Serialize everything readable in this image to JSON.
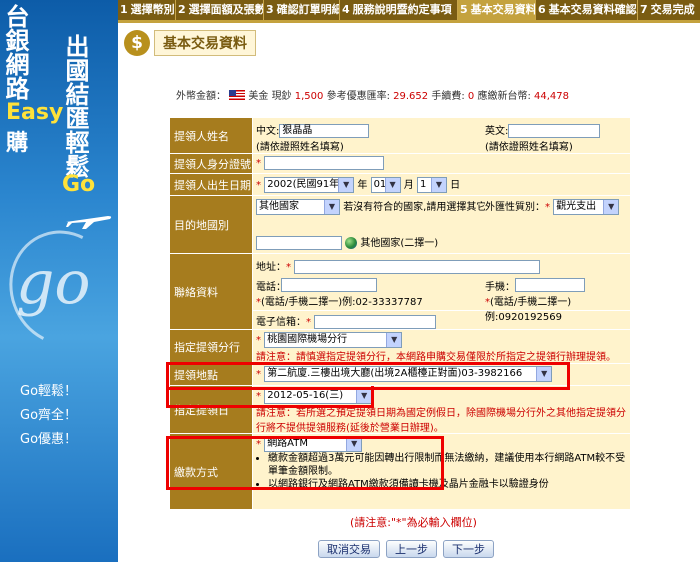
{
  "sidebar": {
    "title_left": "台銀網路",
    "title_right": "出國結匯輕鬆",
    "easy": "Easy",
    "buy": "購",
    "go": "Go",
    "slogans": [
      "Go輕鬆！",
      "Go齊全！",
      "Go優惠！"
    ]
  },
  "steps": [
    {
      "num": "1",
      "label": "選擇幣別"
    },
    {
      "num": "2",
      "label": "選擇面額及張數"
    },
    {
      "num": "3",
      "label": "確認訂單明細"
    },
    {
      "num": "4",
      "label": "服務說明暨約定事項"
    },
    {
      "num": "5",
      "label": "基本交易資料"
    },
    {
      "num": "6",
      "label": "基本交易資料確認"
    },
    {
      "num": "7",
      "label": "交易完成"
    }
  ],
  "page_title": "基本交易資料",
  "fx": {
    "amount_label": "外幣金額：",
    "currency": "美金",
    "cash_label": "現鈔",
    "amount": "1,500",
    "rate_label": "參考優惠匯率:",
    "rate": "29.652",
    "fee_label": "手續費:",
    "fee": "0",
    "total_label": "應繳新台幣:",
    "total": "44,478"
  },
  "form": {
    "name": {
      "label": "提領人姓名",
      "zh_label": "中文:",
      "zh_value": "狠晶晶",
      "zh_hint": "(請依證照姓名填寫)",
      "en_label": "英文:",
      "en_hint": "(請依證照姓名填寫)"
    },
    "id": {
      "label": "提領人身分證號"
    },
    "birth": {
      "label": "提領人出生日期",
      "year": "2002(民國91年)",
      "year_unit": "年",
      "month": "01",
      "month_unit": "月",
      "day": "1",
      "day_unit": "日"
    },
    "dest": {
      "label": "目的地國別",
      "country": "其他國家",
      "hint": "若沒有符合的國家,請用選擇其它國家(二擇一)",
      "purpose_label": "外匯性質別：",
      "purpose": "觀光支出",
      "other_label": "其他國家(二擇一)"
    },
    "contact": {
      "label": "聯絡資料",
      "address_label": "地址：",
      "phone_label": "電話：",
      "phone_hint": "(電話/手機二擇一)例:02-33337787",
      "mobile_label": "手機：",
      "mobile_hint": "(電話/手機二擇一)例:0920192569",
      "email_label": "電子信箱："
    },
    "branch": {
      "label": "指定提領分行",
      "value": "桃園國際機場分行",
      "warn": "請注意：請慎選指定提領分行，本網路申購交易僅限於所指定之提領行辦理提領。"
    },
    "location": {
      "label": "提領地點",
      "value": "第二航廈.三樓出境大廳(出境2A櫃檯正對面)03-3982166"
    },
    "date": {
      "label": "指定提領日",
      "value": "2012-05-16(三)",
      "warn": "請注意：若所選之預定提領日期為國定例假日，除國際機場分行外之其他指定提領分行將不提供提領服務(延後於營業日辦理)。"
    },
    "payment": {
      "label": "繳款方式",
      "value": "網路ATM",
      "bullets": [
        "繳款金額超過3萬元可能因轉出行限制而無法繳納，建議使用本行網路ATM較不受單筆金額限制。",
        "以網路銀行及網路ATM繳款須備讀卡機及晶片金融卡以驗證身份"
      ]
    }
  },
  "note": "(請注意:\"*\"為必輸入欄位)",
  "buttons": {
    "cancel": "取消交易",
    "prev": "上一步",
    "next": "下一步"
  }
}
